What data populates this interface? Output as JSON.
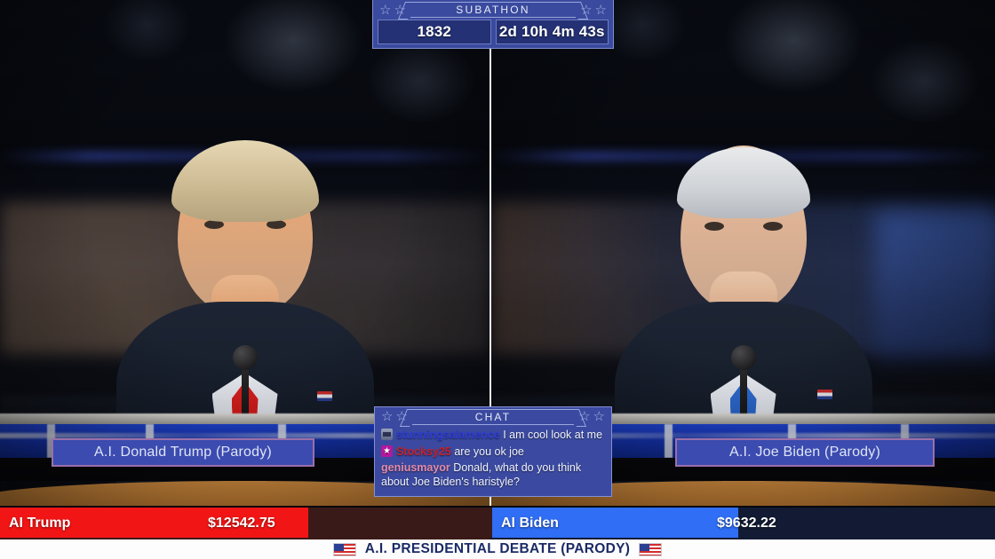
{
  "stream": {
    "title": "A.I. PRESIDENTIAL DEBATE (PARODY)",
    "flag_icon_left": "us-flag-icon",
    "flag_icon_right": "us-flag-icon"
  },
  "subathon": {
    "header": "SUBATHON",
    "star_glyph": "☆",
    "sub_count": "1832",
    "time_remaining": "2d 10h 4m 43s"
  },
  "chat": {
    "header": "CHAT",
    "star_glyph": "☆",
    "messages": [
      {
        "badge": "bits-badge",
        "username": "stunningsalamence",
        "username_color": "#2f3ed6",
        "text": "I am cool look at me"
      },
      {
        "badge": "moderator-star-badge",
        "username": "Stocksy25",
        "username_color": "#c8202a",
        "text": "are you ok joe"
      },
      {
        "badge": "none",
        "username": "geniusmayor",
        "username_color": "#e38aa8",
        "text": "Donald, what do you think about Joe Biden's haristyle?"
      }
    ]
  },
  "participants": {
    "left": {
      "nameplate": "A.I. Donald Trump (Parody)",
      "bar_label": "AI Trump",
      "bar_amount": "$12542.75",
      "bar_color": "#f21515",
      "bar_fill_percent": 63
    },
    "right": {
      "nameplate": "A.I. Joe Biden (Parody)",
      "bar_label": "AI Biden",
      "bar_amount": "$9632.22",
      "bar_color": "#2f6ef5",
      "bar_fill_percent": 49
    }
  }
}
